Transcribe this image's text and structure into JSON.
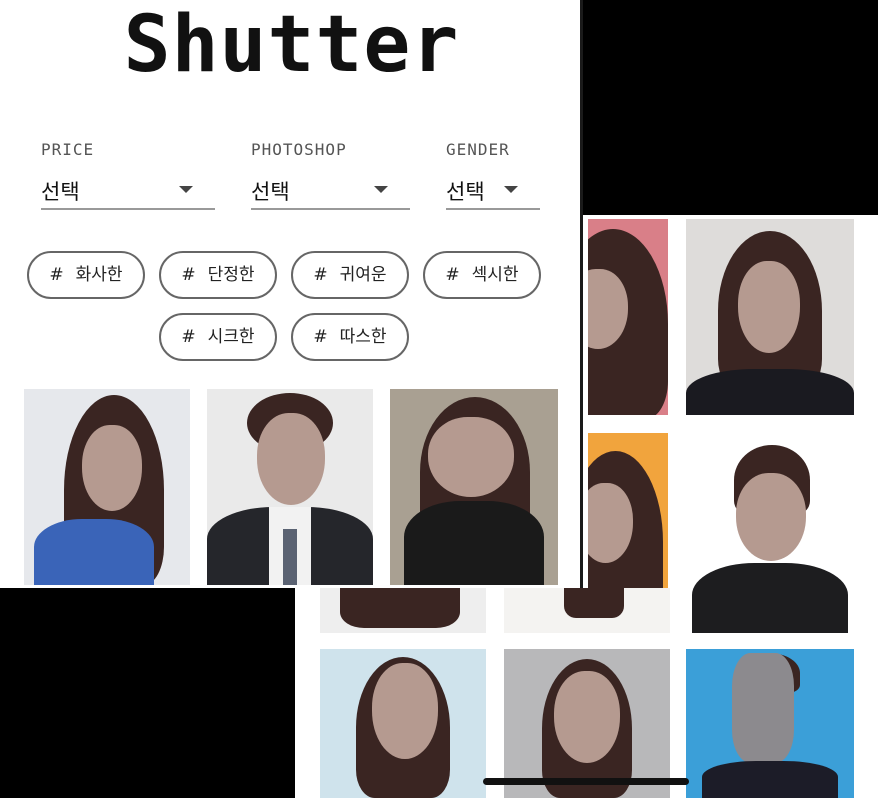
{
  "app": {
    "title": "Shutter"
  },
  "filters": [
    {
      "label": "PRICE",
      "value": "선택"
    },
    {
      "label": "PHOTOSHOP",
      "value": "선택"
    },
    {
      "label": "GENDER",
      "value": "선택"
    }
  ],
  "tags": [
    "화사한",
    "단정한",
    "귀여운",
    "섹시한",
    "시크한",
    "따스한"
  ],
  "tag_prefix": "#",
  "gallery": {
    "front_thumbnails": [
      "female-portrait-blue-plaid",
      "male-portrait-suit",
      "female-portrait-black-top"
    ],
    "back_thumbnails": [
      "female-pink-bg",
      "female-grey-bg",
      "female-orange-bg",
      "female-suit-white-bg",
      "female-light-blue-bg",
      "female-grey-gradient-bg",
      "male-blue-bg"
    ]
  },
  "colors": {
    "chip_border": "#666666",
    "title": "#111111",
    "underline": "#999999"
  }
}
